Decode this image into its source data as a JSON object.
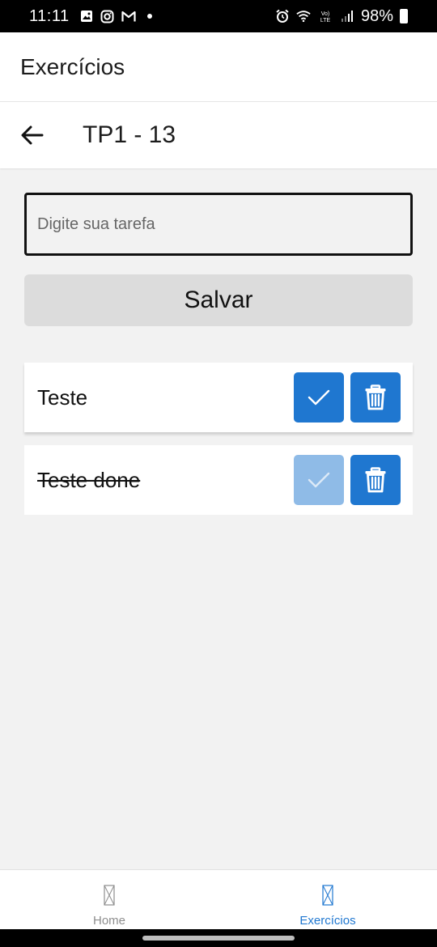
{
  "status_bar": {
    "time": "11:11",
    "battery": "98%",
    "icons_left": [
      "gallery-icon",
      "instagram-icon",
      "gmail-icon",
      "dot-icon"
    ],
    "icons_right": [
      "alarm-icon",
      "wifi-icon",
      "volte-icon",
      "signal-icon",
      "battery-icon"
    ],
    "volte_label": "Vo) LTE"
  },
  "header": {
    "title": "Exercícios"
  },
  "sub_header": {
    "title": "TP1 - 13",
    "back_icon": "arrow-left-icon"
  },
  "form": {
    "input_placeholder": "Digite sua tarefa",
    "input_value": "",
    "save_label": "Salvar"
  },
  "tasks": [
    {
      "label": "Teste",
      "done": false
    },
    {
      "label": "Teste done",
      "done": true
    }
  ],
  "bottom_nav": {
    "items": [
      {
        "label": "Home",
        "active": false
      },
      {
        "label": "Exercícios",
        "active": true
      }
    ]
  },
  "colors": {
    "accent": "#1f77d0",
    "accent_disabled": "#8fbbe7",
    "background": "#f2f2f2",
    "save_button": "#dcdcdc"
  }
}
